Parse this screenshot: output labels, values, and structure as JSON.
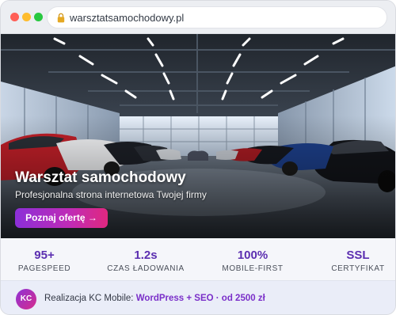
{
  "browser": {
    "url": "warsztatsamochodowy.pl",
    "window_controls": [
      "close",
      "minimize",
      "maximize"
    ]
  },
  "hero": {
    "title": "Warsztat samochodowy",
    "subtitle": "Profesjonalna strona internetowa Twojej firmy",
    "cta_label": "Poznaj ofertę →"
  },
  "stats": [
    {
      "value": "95+",
      "label": "PAGESPEED"
    },
    {
      "value": "1.2s",
      "label": "CZAS ŁADOWANIA"
    },
    {
      "value": "100%",
      "label": "MOBILE-FIRST"
    },
    {
      "value": "SSL",
      "label": "CERTYFIKAT"
    }
  ],
  "footer": {
    "avatar_initials": "KC",
    "text_prefix": "Realizacja KC Mobile: ",
    "text_highlight": "WordPress + SEO · od 2500 zł"
  },
  "colors": {
    "accent_purple": "#8b2fd8",
    "accent_pink": "#e0287f",
    "stat_value": "#5b2eb0",
    "hero_icon": "car-showroom-photo"
  }
}
